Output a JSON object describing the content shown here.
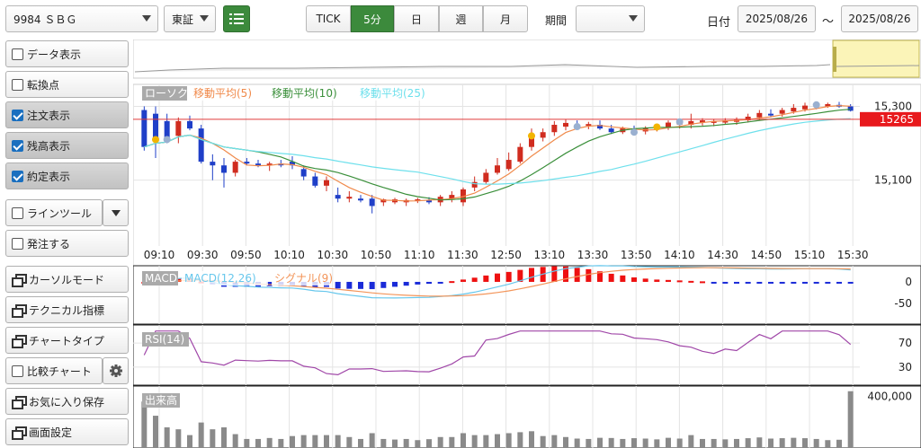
{
  "toolbar": {
    "symbol": "9984 ＳＢＧ",
    "exchange": "東証",
    "tick": "TICK",
    "min5": "5分",
    "day": "日",
    "week": "週",
    "month": "月",
    "period_label": "期間",
    "period_value": "",
    "date_label": "日付",
    "date_from": "2025/08/26",
    "date_sep": "～",
    "date_to": "2025/08/26"
  },
  "sidebar": {
    "items": [
      {
        "label": "データ表示",
        "checked": false
      },
      {
        "label": "転換点",
        "checked": false
      },
      {
        "label": "注文表示",
        "checked": true
      },
      {
        "label": "残高表示",
        "checked": true
      },
      {
        "label": "約定表示",
        "checked": true
      },
      {
        "label": "ラインツール",
        "checked": false
      },
      {
        "label": "発注する",
        "checked": false
      }
    ],
    "buttons": [
      "カーソルモード",
      "テクニカル指標",
      "チャートタイプ",
      "比較チャート",
      "お気に入り保存",
      "画面設定"
    ]
  },
  "colors": {
    "up": "#d02c1f",
    "down": "#1f3fc8",
    "ma5": "#f08a4b",
    "ma10": "#3a8f3a",
    "ma25": "#6ee0ec",
    "macd": "#67c7ec",
    "signal": "#f3955a",
    "rsi": "#a047a8",
    "price_line": "#e03a3a",
    "active": "#3c8a3c"
  },
  "chart_data": [
    {
      "type": "candlestick",
      "legend": [
        "ローソク",
        "移動平均(5)",
        "移動平均(10)",
        "移動平均(25)"
      ],
      "x_ticks": [
        "09:10",
        "09:30",
        "09:50",
        "10:10",
        "10:30",
        "10:50",
        "11:10",
        "11:30",
        "12:50",
        "13:10",
        "13:30",
        "13:50",
        "14:10",
        "14:30",
        "14:50",
        "15:10",
        "15:30"
      ],
      "y_ticks": [
        15300,
        15100
      ],
      "ylim": [
        14980,
        15340
      ],
      "current_price": 15265,
      "current_price_label": "15265",
      "candles": [
        {
          "o": 15290,
          "h": 15300,
          "l": 15180,
          "c": 15190
        },
        {
          "o": 15280,
          "h": 15300,
          "l": 15160,
          "c": 15210
        },
        {
          "o": 15260,
          "h": 15280,
          "l": 15200,
          "c": 15210
        },
        {
          "o": 15220,
          "h": 15270,
          "l": 15200,
          "c": 15260
        },
        {
          "o": 15260,
          "h": 15275,
          "l": 15235,
          "c": 15240
        },
        {
          "o": 15240,
          "h": 15250,
          "l": 15145,
          "c": 15150
        },
        {
          "o": 15150,
          "h": 15170,
          "l": 15100,
          "c": 15140
        },
        {
          "o": 15140,
          "h": 15160,
          "l": 15080,
          "c": 15120
        },
        {
          "o": 15120,
          "h": 15155,
          "l": 15110,
          "c": 15150
        },
        {
          "o": 15150,
          "h": 15160,
          "l": 15140,
          "c": 15145
        },
        {
          "o": 15145,
          "h": 15155,
          "l": 15135,
          "c": 15140
        },
        {
          "o": 15140,
          "h": 15150,
          "l": 15125,
          "c": 15145
        },
        {
          "o": 15145,
          "h": 15155,
          "l": 15135,
          "c": 15140
        },
        {
          "o": 15150,
          "h": 15165,
          "l": 15130,
          "c": 15140
        },
        {
          "o": 15130,
          "h": 15140,
          "l": 15100,
          "c": 15110
        },
        {
          "o": 15110,
          "h": 15120,
          "l": 15080,
          "c": 15085
        },
        {
          "o": 15085,
          "h": 15110,
          "l": 15070,
          "c": 15100
        },
        {
          "o": 15060,
          "h": 15080,
          "l": 15040,
          "c": 15050
        },
        {
          "o": 15050,
          "h": 15070,
          "l": 15040,
          "c": 15055
        },
        {
          "o": 15050,
          "h": 15060,
          "l": 15040,
          "c": 15045
        },
        {
          "o": 15050,
          "h": 15060,
          "l": 15010,
          "c": 15030
        },
        {
          "o": 15040,
          "h": 15050,
          "l": 15030,
          "c": 15048
        },
        {
          "o": 15040,
          "h": 15052,
          "l": 15035,
          "c": 15048
        },
        {
          "o": 15040,
          "h": 15050,
          "l": 15030,
          "c": 15046
        },
        {
          "o": 15044,
          "h": 15052,
          "l": 15038,
          "c": 15048
        },
        {
          "o": 15046,
          "h": 15054,
          "l": 15035,
          "c": 15040
        },
        {
          "o": 15040,
          "h": 15060,
          "l": 15030,
          "c": 15055
        },
        {
          "o": 15050,
          "h": 15070,
          "l": 15040,
          "c": 15060
        },
        {
          "o": 15040,
          "h": 15080,
          "l": 15030,
          "c": 15075
        },
        {
          "o": 15080,
          "h": 15110,
          "l": 15070,
          "c": 15095
        },
        {
          "o": 15095,
          "h": 15130,
          "l": 15090,
          "c": 15120
        },
        {
          "o": 15120,
          "h": 15160,
          "l": 15115,
          "c": 15140
        },
        {
          "o": 15130,
          "h": 15175,
          "l": 15125,
          "c": 15155
        },
        {
          "o": 15150,
          "h": 15200,
          "l": 15145,
          "c": 15190
        },
        {
          "o": 15190,
          "h": 15240,
          "l": 15180,
          "c": 15220
        },
        {
          "o": 15215,
          "h": 15240,
          "l": 15205,
          "c": 15230
        },
        {
          "o": 15230,
          "h": 15260,
          "l": 15220,
          "c": 15250
        },
        {
          "o": 15245,
          "h": 15265,
          "l": 15235,
          "c": 15255
        },
        {
          "o": 15250,
          "h": 15262,
          "l": 15240,
          "c": 15245
        },
        {
          "o": 15248,
          "h": 15258,
          "l": 15238,
          "c": 15252
        },
        {
          "o": 15250,
          "h": 15262,
          "l": 15236,
          "c": 15240
        },
        {
          "o": 15240,
          "h": 15250,
          "l": 15225,
          "c": 15230
        },
        {
          "o": 15230,
          "h": 15245,
          "l": 15225,
          "c": 15240
        },
        {
          "o": 15238,
          "h": 15248,
          "l": 15224,
          "c": 15230
        },
        {
          "o": 15232,
          "h": 15246,
          "l": 15224,
          "c": 15240
        },
        {
          "o": 15238,
          "h": 15250,
          "l": 15232,
          "c": 15244
        },
        {
          "o": 15244,
          "h": 15262,
          "l": 15236,
          "c": 15256
        },
        {
          "o": 15250,
          "h": 15262,
          "l": 15240,
          "c": 15258
        },
        {
          "o": 15250,
          "h": 15280,
          "l": 15240,
          "c": 15260
        },
        {
          "o": 15256,
          "h": 15268,
          "l": 15248,
          "c": 15262
        },
        {
          "o": 15256,
          "h": 15266,
          "l": 15246,
          "c": 15260
        },
        {
          "o": 15256,
          "h": 15268,
          "l": 15250,
          "c": 15262
        },
        {
          "o": 15258,
          "h": 15270,
          "l": 15250,
          "c": 15264
        },
        {
          "o": 15262,
          "h": 15280,
          "l": 15256,
          "c": 15272
        },
        {
          "o": 15270,
          "h": 15290,
          "l": 15262,
          "c": 15282
        },
        {
          "o": 15280,
          "h": 15292,
          "l": 15270,
          "c": 15278
        },
        {
          "o": 15280,
          "h": 15296,
          "l": 15272,
          "c": 15290
        },
        {
          "o": 15286,
          "h": 15306,
          "l": 15280,
          "c": 15296
        },
        {
          "o": 15292,
          "h": 15310,
          "l": 15286,
          "c": 15302
        },
        {
          "o": 15300,
          "h": 15312,
          "l": 15292,
          "c": 15304
        },
        {
          "o": 15300,
          "h": 15310,
          "l": 15296,
          "c": 15306
        },
        {
          "o": 15304,
          "h": 15312,
          "l": 15296,
          "c": 15302
        },
        {
          "o": 15300,
          "h": 15306,
          "l": 15286,
          "c": 15288
        }
      ]
    },
    {
      "type": "bar+line",
      "legend": [
        "MACD",
        "MACD(12,26)",
        "シグナル(9)"
      ],
      "y_ticks": [
        0,
        -50
      ],
      "ylim": [
        -90,
        25
      ]
    },
    {
      "type": "line",
      "legend": [
        "RSI(14)"
      ],
      "y_ticks": [
        70,
        30
      ],
      "ylim": [
        0,
        100
      ]
    },
    {
      "type": "bar",
      "legend": [
        "出来高"
      ],
      "y_ticks": [
        400000
      ],
      "ylim": [
        0,
        480000
      ]
    }
  ]
}
